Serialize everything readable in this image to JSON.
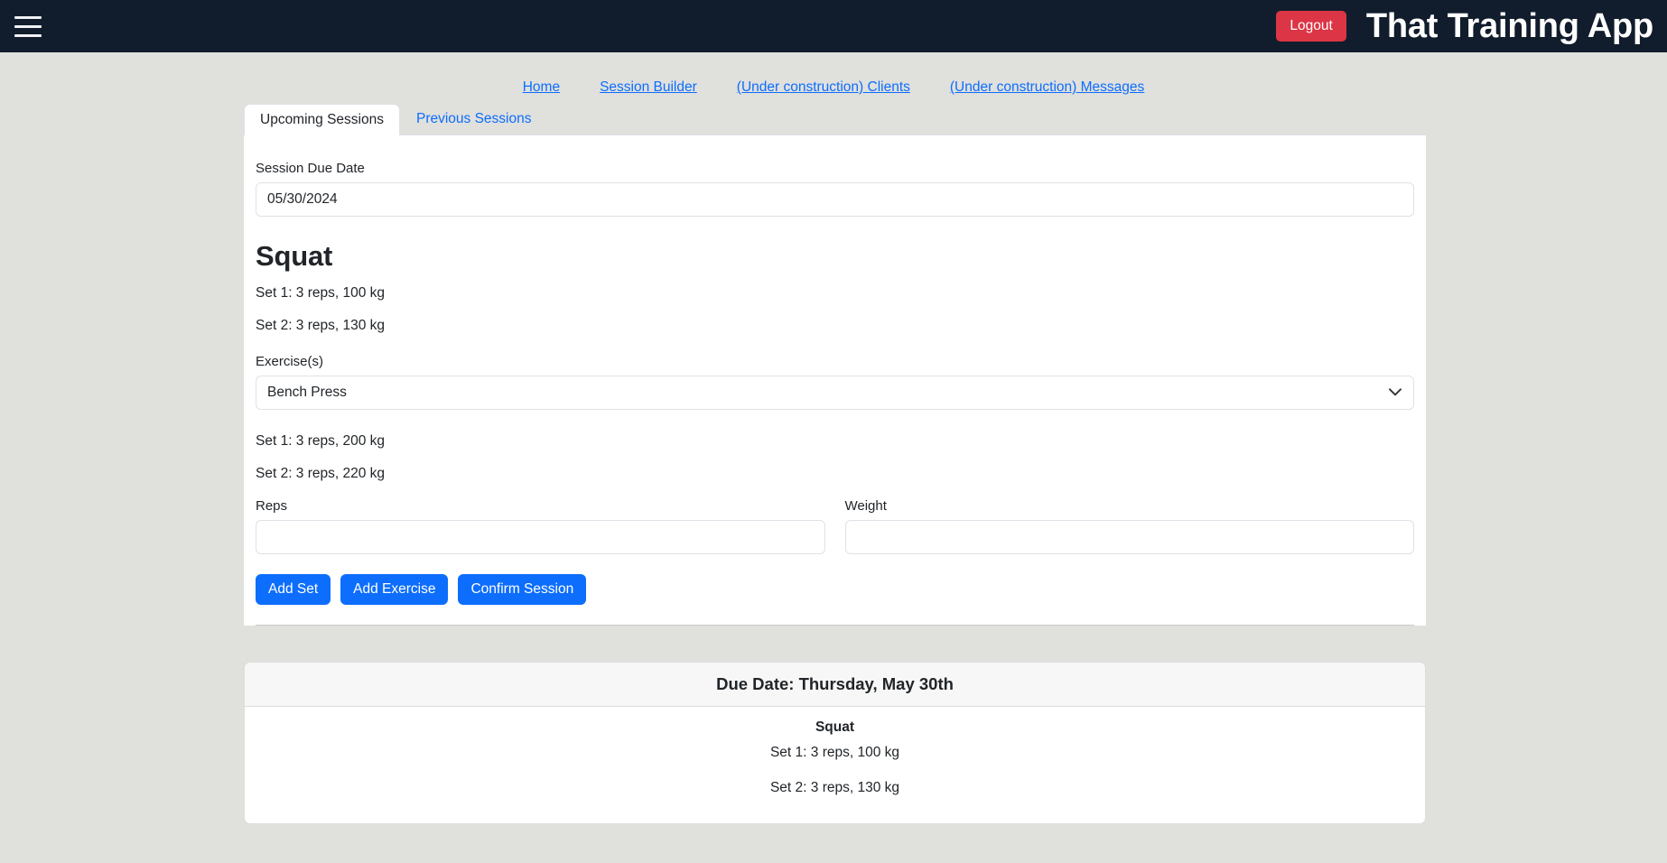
{
  "navbar": {
    "menu_icon": "hamburger-menu-icon",
    "logout_label": "Logout",
    "app_title": "That Training App",
    "logout_color": "#dc3545",
    "background_color": "#111d2c"
  },
  "nav_links": [
    {
      "label": "Home"
    },
    {
      "label": "Session Builder"
    },
    {
      "label": "(Under construction) Clients"
    },
    {
      "label": "(Under construction) Messages"
    }
  ],
  "tabs": [
    {
      "label": "Upcoming Sessions",
      "active": true
    },
    {
      "label": "Previous Sessions",
      "active": false
    }
  ],
  "form": {
    "due_date_label": "Session Due Date",
    "due_date_value": "05/30/2024",
    "exercise_select_label": "Exercise(s)",
    "exercise_select_value": "Bench Press",
    "exercise_options": [
      "Bench Press"
    ],
    "reps_label": "Reps",
    "reps_value": "",
    "weight_label": "Weight",
    "weight_value": "",
    "chevron_icon": "chevron-down-icon"
  },
  "builder_exercise": {
    "name": "Squat",
    "sets": [
      "Set 1: 3 reps, 100 kg",
      "Set 2: 3 reps, 130 kg"
    ]
  },
  "selected_exercise_sets": [
    "Set 1: 3 reps, 200 kg",
    "Set 2: 3 reps, 220 kg"
  ],
  "buttons": {
    "add_set": "Add Set",
    "add_exercise": "Add Exercise",
    "confirm_session": "Confirm Session",
    "primary_color": "#0d6efd"
  },
  "session_card": {
    "header": "Due Date: Thursday, May 30th",
    "exercise_name": "Squat",
    "sets": [
      "Set 1: 3 reps, 100 kg",
      "Set 2: 3 reps, 130 kg"
    ]
  }
}
